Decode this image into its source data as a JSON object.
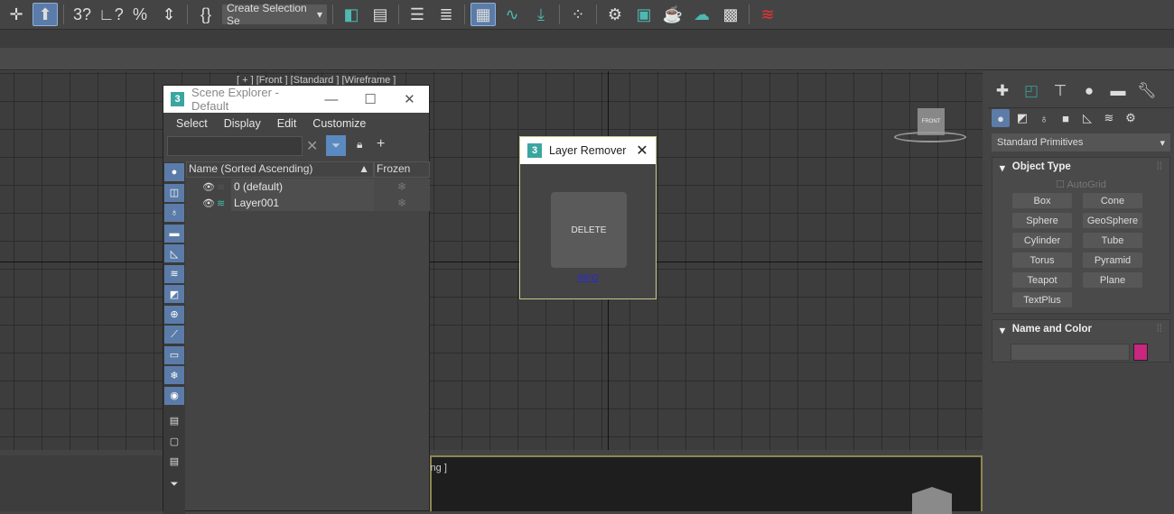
{
  "toolbar": {
    "items": [
      "move-icon",
      "select-object-icon",
      "snap-3d-icon",
      "angle-snap-icon",
      "percent-snap-icon",
      "spinner-snap-icon",
      "edit-named-selection-icon",
      "mirror-icon",
      "align-icon",
      "scene-explorer-icon",
      "layer-explorer-icon",
      "toggle-ribbon-icon",
      "curve-editor-icon",
      "dope-sheet-icon",
      "schematic-view-icon",
      "render-setup-icon",
      "rendered-frame-window-icon",
      "render-production-icon",
      "render-cloud-icon",
      "environment-icon",
      "delete-layer-icon"
    ],
    "selection_set": "Create Selection Se"
  },
  "viewport": {
    "top_label": "[ + ] [Front ] [Standard ] [Wireframe ]",
    "bottom_label": "ding ]",
    "viewcube_label": "FRONT"
  },
  "scene_explorer": {
    "title": "Scene Explorer - Default",
    "menu": [
      "Select",
      "Display",
      "Edit",
      "Customize"
    ],
    "search_value": "",
    "columns": {
      "name": "Name (Sorted Ascending)",
      "frozen": "Frozen"
    },
    "rows": [
      {
        "name": "0 (default)"
      },
      {
        "name": "Layer001"
      }
    ]
  },
  "layer_remover": {
    "title": "Layer Remover",
    "delete_label": "DELETE",
    "info_label": "INFO"
  },
  "command_panel": {
    "dropdown": "Standard Primitives",
    "object_type": {
      "title": "Object Type",
      "autogrid": "AutoGrid",
      "buttons": [
        "Box",
        "Cone",
        "Sphere",
        "GeoSphere",
        "Cylinder",
        "Tube",
        "Torus",
        "Pyramid",
        "Teapot",
        "Plane",
        "TextPlus"
      ]
    },
    "name_color": {
      "title": "Name and Color",
      "name_value": "",
      "color": "#c8267f"
    }
  },
  "colors": {
    "accent": "#5b7ca8",
    "viewport_border": "#8e8653"
  }
}
